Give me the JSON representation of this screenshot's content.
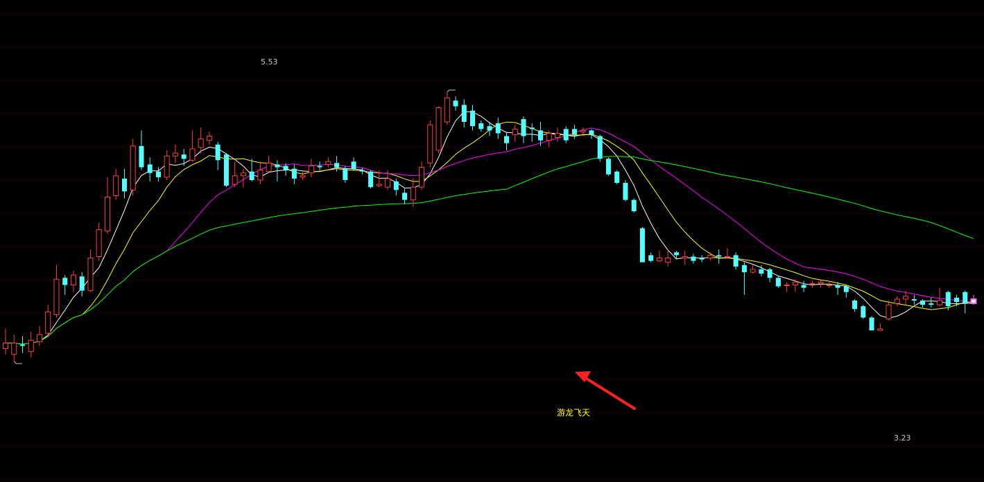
{
  "chart_data": {
    "type": "candlestick",
    "ylim": [
      2.78,
      6.18
    ],
    "grid": true,
    "colors": {
      "background": "#000000",
      "grid": "#7a0000",
      "up": "#ff4040",
      "down": "#54ffff",
      "signal_candle": "#ff66ff",
      "ma_white": "#ffffff",
      "ma_yellow": "#ffff00",
      "ma_magenta": "#ff00ff",
      "ma_green": "#00ff00",
      "arrow": "#ff2020"
    },
    "annotations": {
      "high_label": "5.53",
      "low_label": "3.23",
      "signal_label": "游龙飞天"
    },
    "signal_index": 114,
    "candles": [
      [
        3.72,
        3.76,
        3.86,
        3.68
      ],
      [
        3.68,
        3.76,
        3.82,
        3.63
      ],
      [
        3.75,
        3.74,
        3.81,
        3.69
      ],
      [
        3.7,
        3.78,
        3.84,
        3.66
      ],
      [
        3.77,
        3.82,
        3.88,
        3.74
      ],
      [
        3.83,
        3.98,
        4.03,
        3.8
      ],
      [
        3.96,
        4.21,
        4.31,
        3.94
      ],
      [
        4.22,
        4.17,
        4.24,
        4.1
      ],
      [
        4.17,
        4.24,
        4.27,
        4.12
      ],
      [
        4.23,
        4.13,
        4.26,
        4.09
      ],
      [
        4.13,
        4.36,
        4.42,
        4.12
      ],
      [
        4.37,
        4.56,
        4.61,
        4.34
      ],
      [
        4.55,
        4.79,
        4.93,
        4.53
      ],
      [
        4.8,
        4.94,
        4.99,
        4.77
      ],
      [
        4.92,
        4.83,
        4.99,
        4.78
      ],
      [
        4.84,
        5.15,
        5.2,
        4.8
      ],
      [
        5.15,
        5.0,
        5.26,
        4.98
      ],
      [
        5.02,
        4.96,
        5.07,
        4.9
      ],
      [
        4.97,
        4.93,
        5.0,
        4.9
      ],
      [
        4.93,
        5.08,
        5.12,
        4.91
      ],
      [
        5.08,
        5.1,
        5.16,
        5.03
      ],
      [
        5.09,
        5.06,
        5.13,
        5.01
      ],
      [
        5.05,
        5.13,
        5.26,
        5.04
      ],
      [
        5.14,
        5.2,
        5.28,
        5.1
      ],
      [
        5.19,
        5.22,
        5.25,
        5.16
      ],
      [
        5.16,
        5.05,
        5.18,
        4.98
      ],
      [
        5.09,
        4.87,
        5.1,
        4.86
      ],
      [
        4.88,
        4.94,
        5.04,
        4.86
      ],
      [
        4.94,
        4.96,
        4.99,
        4.86
      ],
      [
        4.97,
        4.91,
        5.06,
        4.9
      ],
      [
        4.91,
        4.98,
        5.04,
        4.88
      ],
      [
        4.97,
        5.03,
        5.08,
        4.96
      ],
      [
        5.02,
        5.0,
        5.05,
        4.9
      ],
      [
        5.01,
        4.98,
        5.03,
        4.94
      ],
      [
        4.99,
        4.92,
        5.02,
        4.88
      ],
      [
        4.93,
        4.94,
        4.98,
        4.91
      ],
      [
        4.96,
        5.01,
        5.06,
        4.93
      ],
      [
        5.01,
        5.0,
        5.04,
        4.98
      ],
      [
        5.02,
        5.04,
        5.07,
        5.0
      ],
      [
        5.03,
        5.0,
        5.08,
        4.97
      ],
      [
        4.99,
        4.91,
        5.01,
        4.89
      ],
      [
        5.04,
        4.99,
        5.07,
        4.98
      ],
      [
        4.98,
        4.97,
        5.0,
        4.95
      ],
      [
        4.97,
        4.86,
        4.98,
        4.85
      ],
      [
        4.87,
        4.88,
        4.98,
        4.86
      ],
      [
        4.86,
        4.92,
        4.98,
        4.84
      ],
      [
        4.9,
        4.84,
        4.92,
        4.8
      ],
      [
        4.82,
        4.77,
        4.85,
        4.74
      ],
      [
        4.77,
        4.86,
        4.92,
        4.72
      ],
      [
        4.86,
        5.0,
        5.04,
        4.84
      ],
      [
        5.03,
        5.3,
        5.33,
        5.0
      ],
      [
        5.12,
        5.42,
        5.43,
        5.1
      ],
      [
        5.32,
        5.49,
        5.53,
        5.3
      ],
      [
        5.47,
        5.43,
        5.5,
        5.4
      ],
      [
        5.44,
        5.32,
        5.48,
        5.28
      ],
      [
        5.4,
        5.29,
        5.44,
        5.26
      ],
      [
        5.31,
        5.27,
        5.33,
        5.25
      ],
      [
        5.29,
        5.26,
        5.32,
        5.22
      ],
      [
        5.31,
        5.24,
        5.35,
        5.2
      ],
      [
        5.22,
        5.17,
        5.25,
        5.12
      ],
      [
        5.23,
        5.27,
        5.3,
        5.18
      ],
      [
        5.34,
        5.22,
        5.36,
        5.17
      ],
      [
        5.28,
        5.27,
        5.31,
        5.18
      ],
      [
        5.26,
        5.19,
        5.32,
        5.15
      ],
      [
        5.19,
        5.24,
        5.26,
        5.14
      ],
      [
        5.21,
        5.24,
        5.28,
        5.18
      ],
      [
        5.27,
        5.19,
        5.29,
        5.17
      ],
      [
        5.27,
        5.23,
        5.3,
        5.2
      ],
      [
        5.25,
        5.26,
        5.28,
        5.22
      ],
      [
        5.26,
        5.23,
        5.27,
        5.2
      ],
      [
        5.22,
        5.06,
        5.23,
        5.04
      ],
      [
        5.06,
        4.95,
        5.07,
        4.94
      ],
      [
        4.97,
        4.89,
        4.98,
        4.88
      ],
      [
        4.89,
        4.77,
        4.91,
        4.76
      ],
      [
        4.77,
        4.69,
        4.78,
        4.68
      ],
      [
        4.57,
        4.33,
        4.58,
        4.33
      ],
      [
        4.38,
        4.34,
        4.4,
        4.33
      ],
      [
        4.34,
        4.36,
        4.41,
        4.33
      ],
      [
        4.33,
        4.36,
        4.42,
        4.3
      ],
      [
        4.4,
        4.38,
        4.41,
        4.35
      ],
      [
        4.36,
        4.37,
        4.41,
        4.31
      ],
      [
        4.37,
        4.34,
        4.39,
        4.32
      ],
      [
        4.36,
        4.35,
        4.38,
        4.33
      ],
      [
        4.36,
        4.38,
        4.4,
        4.34
      ],
      [
        4.38,
        4.37,
        4.42,
        4.32
      ],
      [
        4.37,
        4.37,
        4.43,
        4.36
      ],
      [
        4.38,
        4.3,
        4.4,
        4.28
      ],
      [
        4.31,
        4.26,
        4.33,
        4.1
      ],
      [
        4.26,
        4.28,
        4.31,
        4.25
      ],
      [
        4.28,
        4.25,
        4.31,
        4.23
      ],
      [
        4.28,
        4.22,
        4.29,
        4.19
      ],
      [
        4.22,
        4.16,
        4.23,
        4.15
      ],
      [
        4.17,
        4.17,
        4.19,
        4.12
      ],
      [
        4.17,
        4.19,
        4.21,
        4.12
      ],
      [
        4.17,
        4.15,
        4.2,
        4.12
      ],
      [
        4.18,
        4.18,
        4.2,
        4.15
      ],
      [
        4.18,
        4.19,
        4.21,
        4.15
      ],
      [
        4.17,
        4.17,
        4.19,
        4.15
      ],
      [
        4.17,
        4.15,
        4.19,
        4.1
      ],
      [
        4.16,
        4.12,
        4.17,
        4.08
      ],
      [
        4.06,
        4.0,
        4.07,
        3.98
      ],
      [
        4.02,
        3.94,
        4.03,
        3.93
      ],
      [
        3.94,
        3.85,
        3.95,
        3.85
      ],
      [
        3.85,
        3.86,
        3.9,
        3.85
      ],
      [
        3.93,
        4.03,
        4.06,
        3.92
      ],
      [
        4.04,
        4.07,
        4.09,
        4.02
      ],
      [
        4.07,
        4.09,
        4.13,
        4.03
      ],
      [
        4.07,
        4.06,
        4.1,
        4.03
      ],
      [
        4.06,
        4.03,
        4.07,
        4.01
      ],
      [
        4.04,
        4.03,
        4.08,
        4.01
      ],
      [
        4.03,
        4.06,
        4.15,
        4.02
      ],
      [
        4.12,
        4.02,
        4.13,
        3.99
      ],
      [
        4.08,
        4.05,
        4.1,
        4.02
      ],
      [
        4.12,
        4.04,
        4.13,
        3.97
      ],
      [
        4.07,
        4.04,
        4.1,
        4.03
      ]
    ]
  }
}
